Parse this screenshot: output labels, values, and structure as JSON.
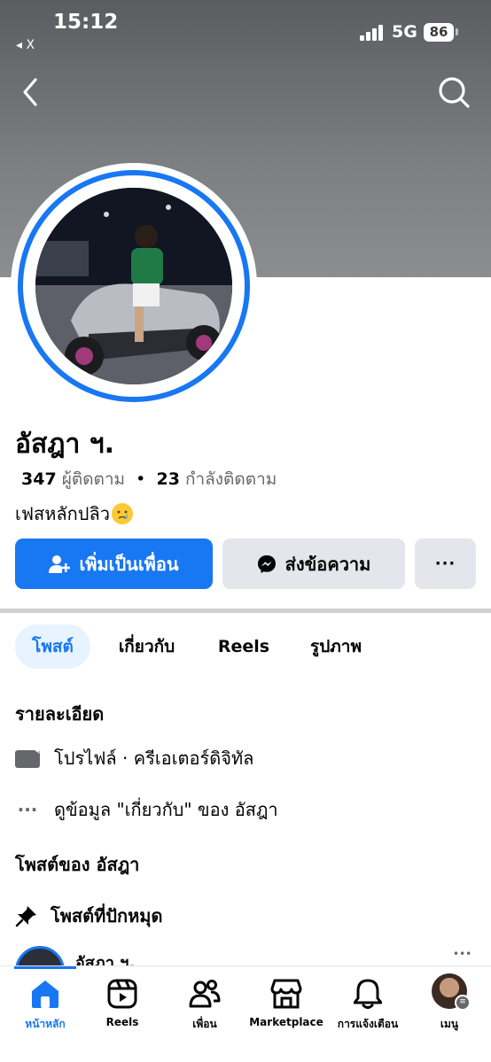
{
  "status_bar": {
    "time": "15:12",
    "back_app": "◂ X",
    "network": "5G",
    "battery": "86"
  },
  "profile": {
    "name": "อัสฎา ฯ.",
    "followers_count": "347",
    "followers_label": "ผู้ติดตาม",
    "separator": "•",
    "following_count": "23",
    "following_label": "กำลังติดตาม",
    "bio": "เฟสหลักปลิว"
  },
  "actions": {
    "add_friend": "เพิ่มเป็นเพื่อน",
    "message": "ส่งข้อความ",
    "more": "···"
  },
  "tabs": [
    {
      "label": "โพสต์",
      "active": true
    },
    {
      "label": "เกี่ยวกับ",
      "active": false
    },
    {
      "label": "Reels",
      "active": false
    },
    {
      "label": "รูปภาพ",
      "active": false
    }
  ],
  "details": {
    "title": "รายละเอียด",
    "profile_type": "โปรไฟล์ · ครีเอเตอร์ดิจิทัล",
    "more_about": "ดูข้อมูล \"เกี่ยวกับ\" ของ อัสฎา",
    "more_icon": "···"
  },
  "posts": {
    "title": "โพสต์ของ อัสฎา",
    "pinned": "โพสต์ที่ปักหมุด",
    "first_post_author": "อัสฎา ฯ.",
    "first_post_more": "•••"
  },
  "bottom_nav": [
    {
      "label": "หน้าหลัก",
      "icon": "home-icon",
      "active": true
    },
    {
      "label": "Reels",
      "icon": "reels-icon",
      "active": false
    },
    {
      "label": "เพื่อน",
      "icon": "friends-icon",
      "active": false
    },
    {
      "label": "Marketplace",
      "icon": "marketplace-icon",
      "active": false
    },
    {
      "label": "การแจ้งเตือน",
      "icon": "bell-icon",
      "active": false
    },
    {
      "label": "เมนู",
      "icon": "menu-avatar",
      "active": false
    }
  ],
  "colors": {
    "brand": "#1877f2",
    "secondary_button": "#e4e6eb",
    "muted_text": "#65676b"
  }
}
